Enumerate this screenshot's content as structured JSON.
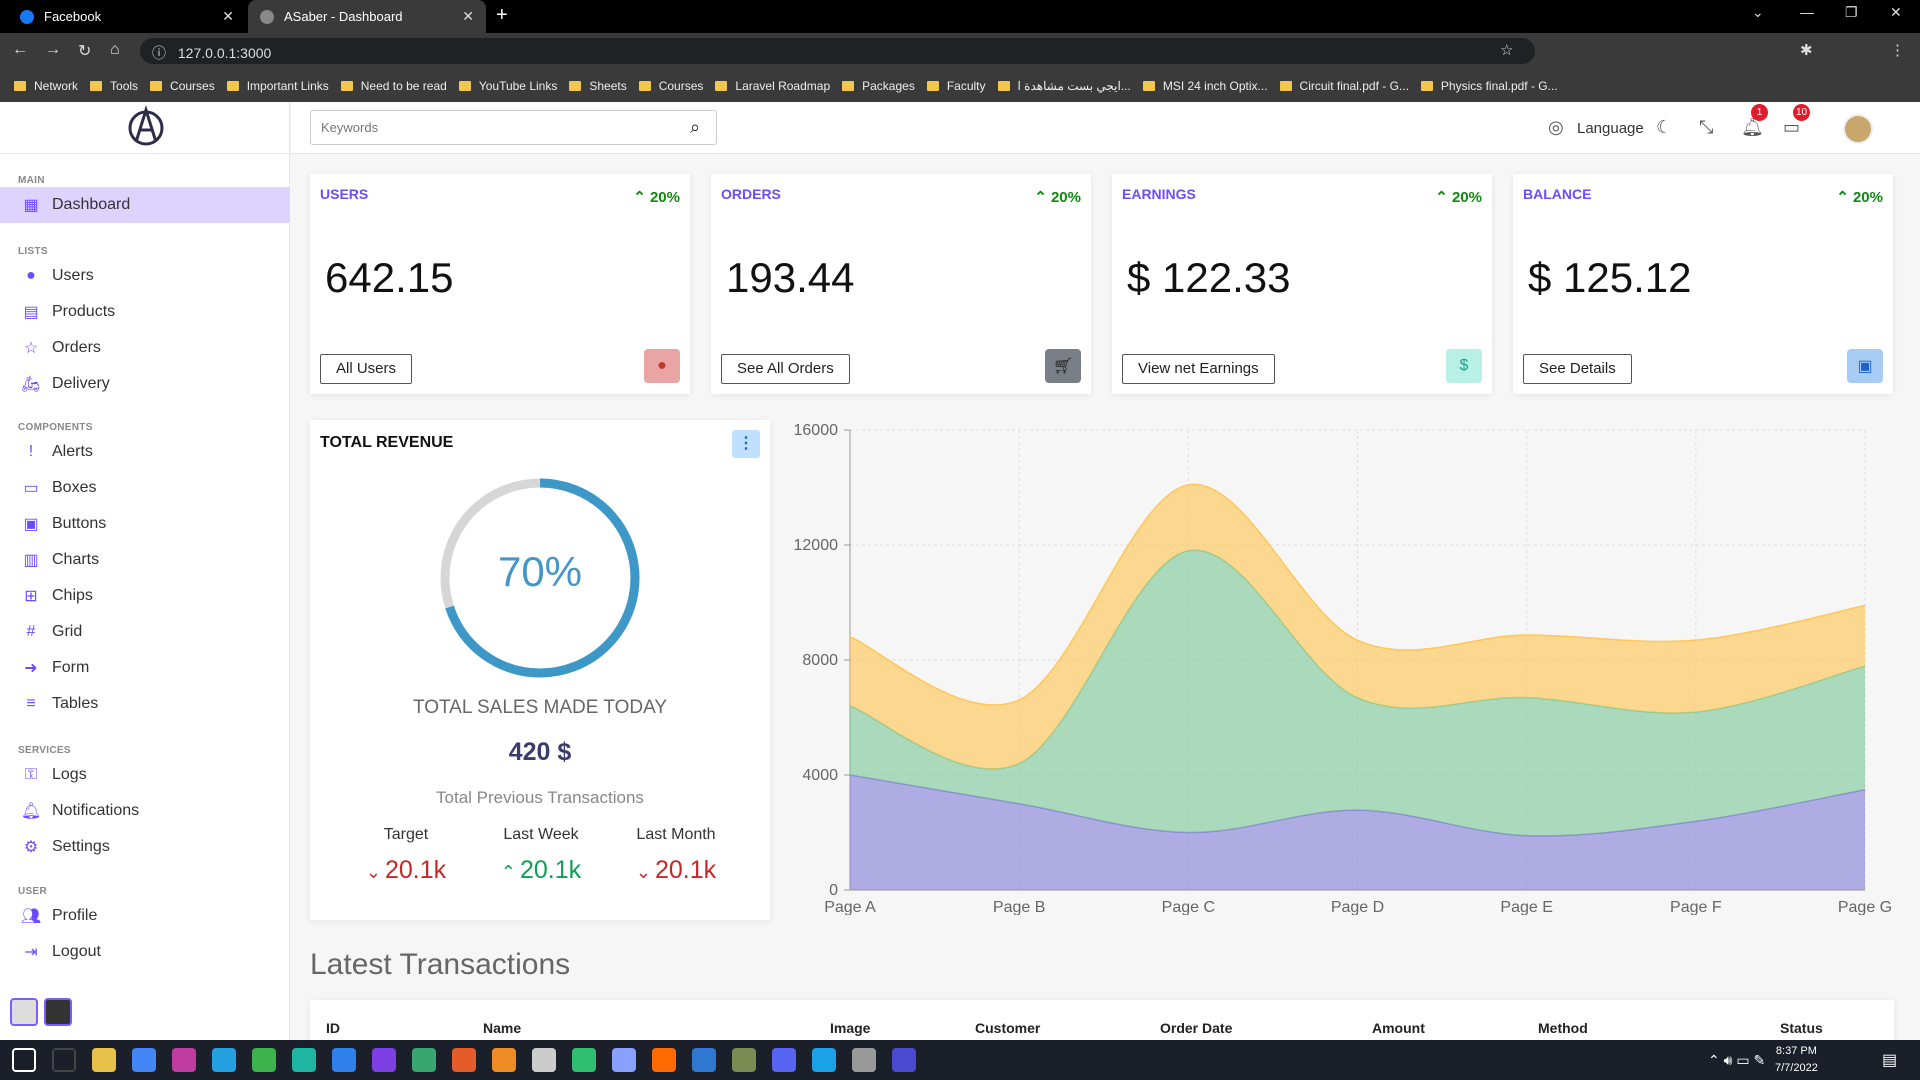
{
  "browser": {
    "tabs": [
      {
        "label": "Facebook",
        "active": false
      },
      {
        "label": "ASaber - Dashboard",
        "active": true
      }
    ],
    "url": "127.0.0.1:3000",
    "bookmarks": [
      "Network",
      "Tools",
      "Courses",
      "Important Links",
      "Need to be read",
      "YouTube Links",
      "Sheets",
      "Courses",
      "Laravel Roadmap",
      "Packages",
      "Faculty",
      "ايجي بست مشاهدة ا...",
      "MSI 24 inch Optix...",
      "Circuit final.pdf - G...",
      "Physics final.pdf - G..."
    ]
  },
  "sidebar": {
    "sections": [
      {
        "title": "MAIN",
        "items": [
          {
            "label": "Dashboard",
            "icon": "dashboard-icon",
            "active": true
          }
        ]
      },
      {
        "title": "LISTS",
        "items": [
          {
            "label": "Users",
            "icon": "person-icon"
          },
          {
            "label": "Products",
            "icon": "box-icon"
          },
          {
            "label": "Orders",
            "icon": "star-icon"
          },
          {
            "label": "Delivery",
            "icon": "scooter-icon"
          }
        ]
      },
      {
        "title": "COMPONENTS",
        "items": [
          {
            "label": "Alerts",
            "icon": "alert-icon"
          },
          {
            "label": "Boxes",
            "icon": "inbox-icon"
          },
          {
            "label": "Buttons",
            "icon": "button-icon"
          },
          {
            "label": "Charts",
            "icon": "bar-chart-icon"
          },
          {
            "label": "Chips",
            "icon": "chip-icon"
          },
          {
            "label": "Grid",
            "icon": "grid-icon"
          },
          {
            "label": "Form",
            "icon": "arrow-right-icon"
          },
          {
            "label": "Tables",
            "icon": "list-icon"
          }
        ]
      },
      {
        "title": "SERVICES",
        "items": [
          {
            "label": "Logs",
            "icon": "key-icon"
          },
          {
            "label": "Notifications",
            "icon": "bell-icon"
          },
          {
            "label": "Settings",
            "icon": "gear-icon"
          }
        ]
      },
      {
        "title": "USER",
        "items": [
          {
            "label": "Profile",
            "icon": "user-settings-icon"
          },
          {
            "label": "Logout",
            "icon": "logout-icon"
          }
        ]
      }
    ]
  },
  "topnav": {
    "search_placeholder": "Keywords",
    "language_label": "Language",
    "notifications_count": "1",
    "messages_count": "10"
  },
  "widgets": [
    {
      "title": "USERS",
      "percent": "20%",
      "value": "642.15",
      "button": "All Users",
      "icon_color": "#e9a4a4",
      "icon_fg": "#c0392b",
      "icon": "person-icon"
    },
    {
      "title": "ORDERS",
      "percent": "20%",
      "value": "193.44",
      "button": "See All Orders",
      "icon_color": "#7a7f87",
      "icon_fg": "#222",
      "icon": "cart-icon"
    },
    {
      "title": "EARNINGS",
      "percent": "20%",
      "value": "$ 122.33",
      "button": "View net Earnings",
      "icon_color": "#b8f0e6",
      "icon_fg": "#1aa389",
      "icon": "dollar-icon"
    },
    {
      "title": "BALANCE",
      "percent": "20%",
      "value": "$ 125.12",
      "button": "See Details",
      "icon_color": "#a8cdf5",
      "icon_fg": "#1b62c9",
      "icon": "wallet-icon"
    }
  ],
  "revenue": {
    "title": "TOTAL REVENUE",
    "progress_text": "70%",
    "progress": 0.7,
    "subtitle": "TOTAL SALES MADE TODAY",
    "amount": "420 $",
    "previous_label": "Total Previous Transactions",
    "summary": [
      {
        "label": "Target",
        "value": "20.1k",
        "trend": "down"
      },
      {
        "label": "Last Week",
        "value": "20.1k",
        "trend": "up"
      },
      {
        "label": "Last Month",
        "value": "20.1k",
        "trend": "down"
      }
    ]
  },
  "chart_data": {
    "type": "area",
    "stacked": true,
    "categories": [
      "Page A",
      "Page B",
      "Page C",
      "Page D",
      "Page E",
      "Page F",
      "Page G"
    ],
    "series": [
      {
        "values": [
          4000,
          3000,
          2000,
          2780,
          1890,
          2390,
          3490
        ],
        "color": "#8884d8"
      },
      {
        "values": [
          2400,
          1400,
          9800,
          3908,
          4800,
          3800,
          4300
        ],
        "color": "#82ca9d"
      },
      {
        "values": [
          2400,
          2210,
          2290,
          2000,
          2181,
          2500,
          2100
        ],
        "color": "#ffc658"
      }
    ],
    "ylim": [
      0,
      16000
    ],
    "yticks": [
      "0",
      "4000",
      "8000",
      "12000",
      "16000"
    ],
    "grid": true
  },
  "transactions": {
    "title": "Latest Transactions",
    "columns": [
      "ID",
      "Name",
      "Image",
      "Customer",
      "Order Date",
      "Amount",
      "Method",
      "Status"
    ]
  },
  "taskbar": {
    "time": "8:37 PM",
    "date": "7/7/2022"
  }
}
